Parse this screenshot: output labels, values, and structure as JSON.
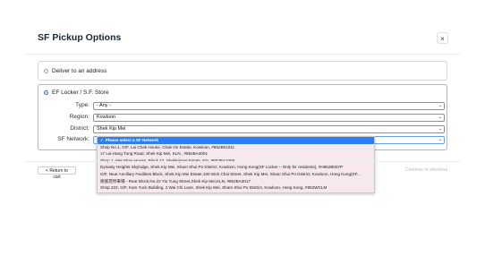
{
  "modal": {
    "title": "SF Pickup Options",
    "close_icon": "×"
  },
  "delivery_options": [
    {
      "label": "Deliver to an address",
      "selected": false
    },
    {
      "label": "EF Locker / S.F. Store",
      "selected": true
    }
  ],
  "form": {
    "type": {
      "label": "Type:",
      "value": "- Any -"
    },
    "region": {
      "label": "Region:",
      "value": "Kowloon"
    },
    "district": {
      "label": "District:",
      "value": "Shek Kip Mei"
    },
    "network": {
      "label": "SF Network:"
    }
  },
  "network_dropdown": {
    "options": [
      {
        "label": "Please select a SF Network",
        "selected": true
      },
      {
        "label": "Shop No.1, G/F, Lai Chak House, Chak On Estate, Kowloon, #852B01011",
        "selected": false
      },
      {
        "label": "17 Lai Hang Tung Road, Shek Kip Mei, KLN , #852BA4001",
        "selected": false
      },
      {
        "label": "Shop 1, Mei Shan House, Block 42, Shekkipmei Estate, Kln, #852BA1006",
        "selected": false
      },
      {
        "label": "Dynasty Heights Skylodge, Shek Kip Mei, Sham Shui Po District, Kowloon, Hong Kong(SF Locker – Only for residents), #H852B057P",
        "selected": false
      },
      {
        "label": "G/F, Near Ancillary Facilities Block, Shek Kip Mei Estate,100 Woh Chai Street, Shek Kip Mei, Sham Shui Po District, Kowloon, Hong Kong(SF...",
        "selected": false
      },
      {
        "label": "德富苑停車場 - Rear Block,No.22 Yiu Tung Street,Shek Kip Mei,KLN, #852BA3017",
        "selected": false
      },
      {
        "label": "Shop 222, G/F, Kam Yuck Building, 2 Wai Chi Lane, Shek Kip Mei, Sham Shui Po District, Kowloon, Hong Kong, #852WCLM",
        "selected": false
      }
    ],
    "highlight_color": "#2d7ff9"
  },
  "footer": {
    "return_label": "< Return to cart",
    "continue_label": "Continue to checkout"
  }
}
